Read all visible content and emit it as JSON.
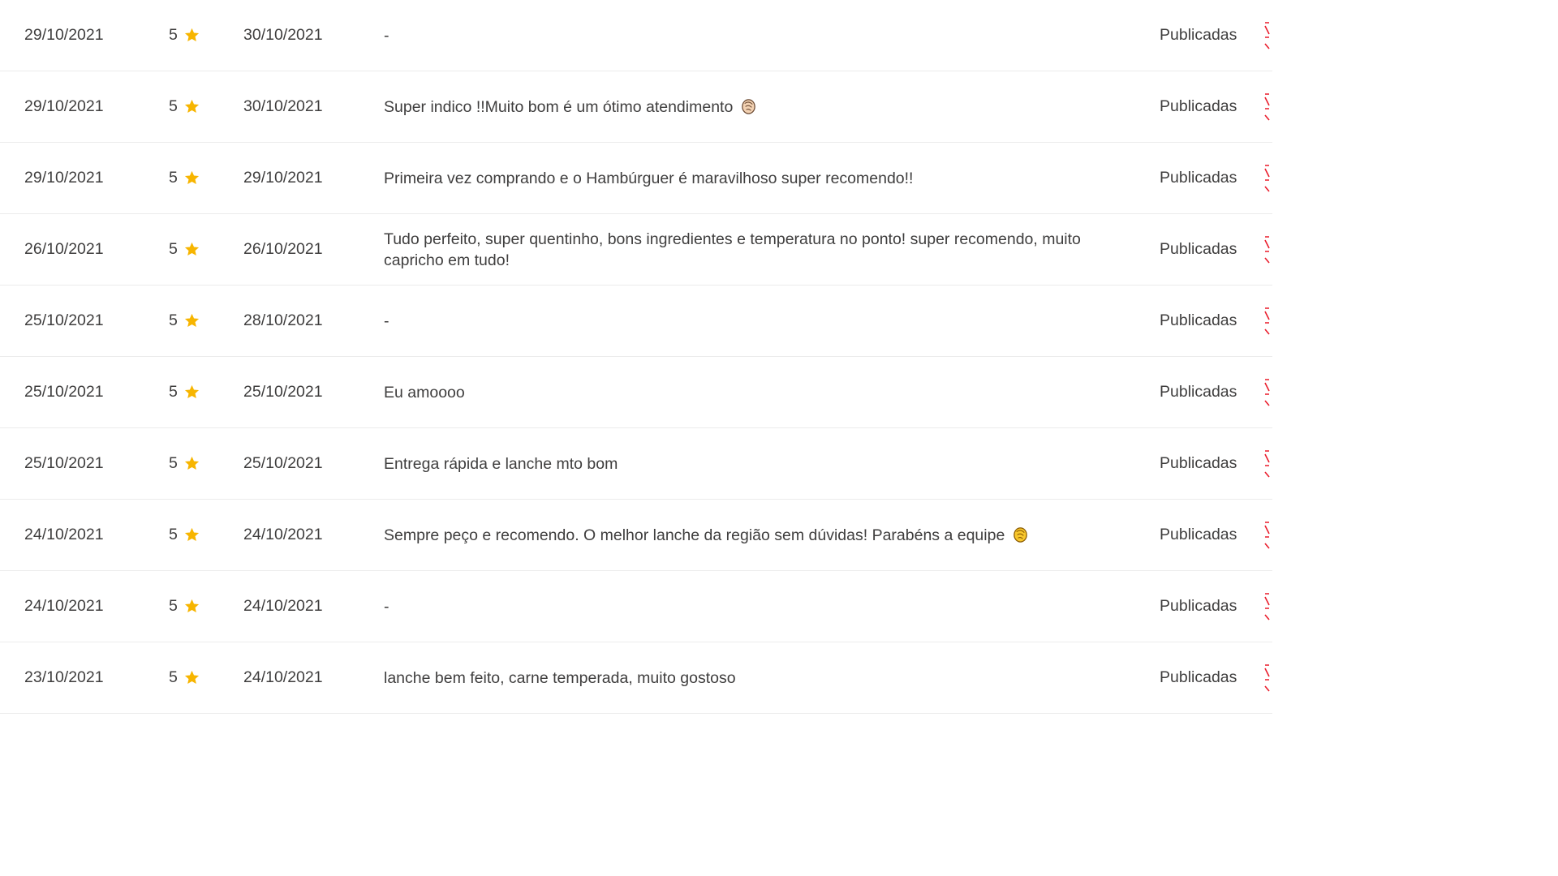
{
  "colors": {
    "text": "#3f3e3e",
    "star": "#f7b500",
    "divider": "#ececec",
    "action": "#ea1d2c"
  },
  "reviews": [
    {
      "date": "29/10/2021",
      "rating": "5",
      "answered": "30/10/2021",
      "comment": "-",
      "emoji": "",
      "status": "Publicadas"
    },
    {
      "date": "29/10/2021",
      "rating": "5",
      "answered": "30/10/2021",
      "comment": "Super indico !!Muito bom é um ótimo atendimento",
      "emoji": "clap-light-icon",
      "status": "Publicadas"
    },
    {
      "date": "29/10/2021",
      "rating": "5",
      "answered": "29/10/2021",
      "comment": "Primeira vez comprando e o Hambúrguer é maravilhoso super recomendo!!",
      "emoji": "",
      "status": "Publicadas"
    },
    {
      "date": "26/10/2021",
      "rating": "5",
      "answered": "26/10/2021",
      "comment": "Tudo perfeito, super quentinho, bons ingredientes e temperatura no ponto! super recomendo, muito capricho em tudo!",
      "emoji": "",
      "status": "Publicadas"
    },
    {
      "date": "25/10/2021",
      "rating": "5",
      "answered": "28/10/2021",
      "comment": "-",
      "emoji": "",
      "status": "Publicadas"
    },
    {
      "date": "25/10/2021",
      "rating": "5",
      "answered": "25/10/2021",
      "comment": "Eu amoooo",
      "emoji": "",
      "status": "Publicadas"
    },
    {
      "date": "25/10/2021",
      "rating": "5",
      "answered": "25/10/2021",
      "comment": "Entrega rápida e lanche mto bom",
      "emoji": "",
      "status": "Publicadas"
    },
    {
      "date": "24/10/2021",
      "rating": "5",
      "answered": "24/10/2021",
      "comment": "Sempre peço e recomendo. O melhor lanche da região sem dúvidas! Parabéns a equipe",
      "emoji": "clap-yellow-icon",
      "status": "Publicadas"
    },
    {
      "date": "24/10/2021",
      "rating": "5",
      "answered": "24/10/2021",
      "comment": "-",
      "emoji": "",
      "status": "Publicadas"
    },
    {
      "date": "23/10/2021",
      "rating": "5",
      "answered": "24/10/2021",
      "comment": "lanche bem feito, carne temperada, muito gostoso",
      "emoji": "",
      "status": "Publicadas"
    }
  ]
}
